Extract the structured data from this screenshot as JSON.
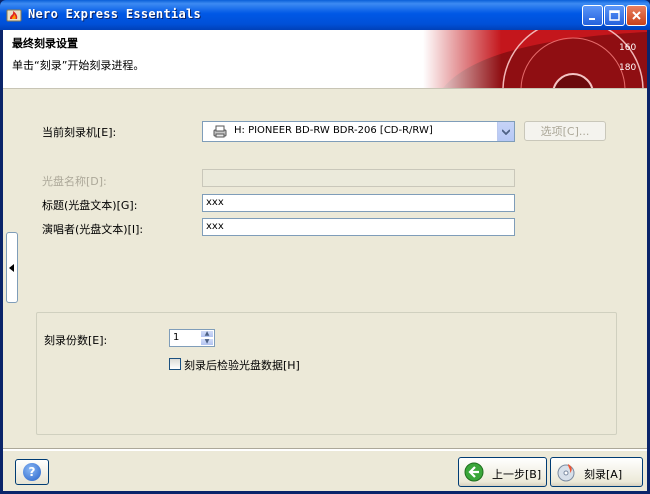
{
  "window": {
    "title": "Nero Express Essentials",
    "minimize_glyph": "_",
    "maximize_glyph": "□",
    "close_glyph": "✕"
  },
  "header": {
    "title": "最终刻录设置",
    "subtitle": "单击“刻录”开始刻录进程。"
  },
  "form": {
    "recorder_label": "当前刻录机[E]:",
    "recorder_value": "H: PIONEER BD-RW   BDR-206   [CD-R/RW]",
    "options_button": "选项[C]...",
    "disc_name_label": "光盘名称[D]:",
    "disc_name_value": "",
    "title_label": "标题(光盘文本)[G]:",
    "title_value": "xxx",
    "artist_label": "演唱者(光盘文本)[I]:",
    "artist_value": "xxx"
  },
  "copies": {
    "label": "刻录份数[E]:",
    "value": "1",
    "verify_label": "刻录后检验光盘数据[H]",
    "verify_checked": false
  },
  "footer": {
    "help_glyph": "?",
    "back_button": "上一步[B]",
    "burn_button": "刻录[A]"
  },
  "icons": {
    "app": "nero-flame-icon",
    "recorder": "drive-printer-icon",
    "back": "green-back-arrow-icon",
    "burn": "burn-disc-icon",
    "side_tab": "collapse-left-icon"
  },
  "colors": {
    "titlebar": "#0054e3",
    "face": "#ece9d8",
    "header_accent": "#c4161c"
  }
}
